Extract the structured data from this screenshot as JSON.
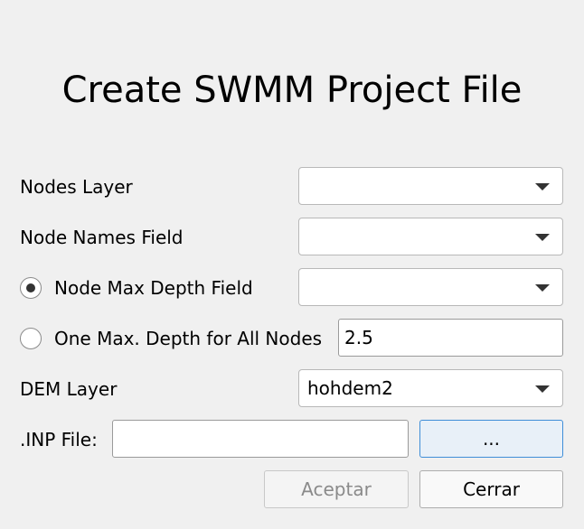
{
  "dialog": {
    "title": "Create SWMM Project File"
  },
  "form": {
    "nodes_layer_label": "Nodes Layer",
    "nodes_layer_value": "",
    "node_names_field_label": "Node Names Field",
    "node_names_field_value": "",
    "node_max_depth_field_label": "Node Max Depth Field",
    "node_max_depth_field_value": "",
    "node_max_depth_field_selected": true,
    "one_max_depth_label": "One Max. Depth for All Nodes",
    "one_max_depth_value": "2.5",
    "one_max_depth_selected": false,
    "dem_layer_label": "DEM Layer",
    "dem_layer_value": "hohdem2",
    "inp_file_label": ".INP File:",
    "inp_file_value": "",
    "browse_label": "..."
  },
  "buttons": {
    "accept_label": "Aceptar",
    "close_label": "Cerrar"
  },
  "icons": {
    "dropdown": "chevron-down-icon",
    "radio_on": "radio-checked-icon",
    "radio_off": "radio-unchecked-icon"
  }
}
